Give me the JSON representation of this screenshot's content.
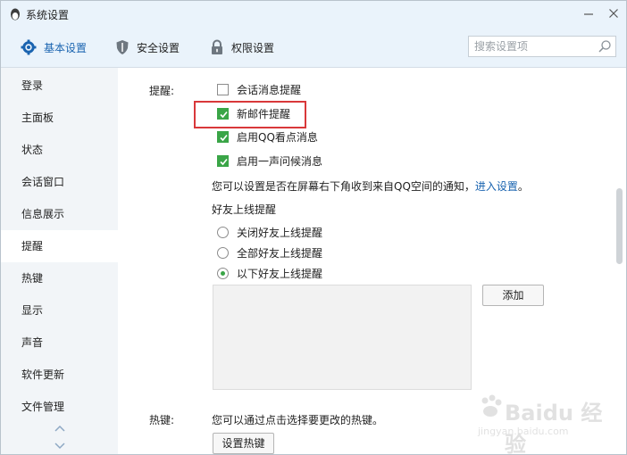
{
  "window": {
    "title": "系统设置"
  },
  "tabs": [
    {
      "label": "基本设置",
      "icon": "gear-icon",
      "active": true
    },
    {
      "label": "安全设置",
      "icon": "shield-icon",
      "active": false
    },
    {
      "label": "权限设置",
      "icon": "lock-icon",
      "active": false
    }
  ],
  "search": {
    "placeholder": "搜索设置项",
    "value": ""
  },
  "sidebar": {
    "items": [
      {
        "label": "登录"
      },
      {
        "label": "主面板"
      },
      {
        "label": "状态"
      },
      {
        "label": "会话窗口"
      },
      {
        "label": "信息展示"
      },
      {
        "label": "提醒",
        "active": true
      },
      {
        "label": "热键"
      },
      {
        "label": "显示"
      },
      {
        "label": "声音"
      },
      {
        "label": "软件更新"
      },
      {
        "label": "文件管理"
      }
    ]
  },
  "reminder": {
    "label": "提醒:",
    "options": [
      {
        "label": "会话消息提醒",
        "checked": false
      },
      {
        "label": "新邮件提醒",
        "checked": true
      },
      {
        "label": "启用QQ看点消息",
        "checked": true
      },
      {
        "label": "启用一声问候消息",
        "checked": true
      }
    ],
    "note": "您可以设置是否在屏幕右下角收到来自QQ空间的通知，",
    "note_link": "进入设置",
    "note_end": "。",
    "friend_online": {
      "title": "好友上线提醒",
      "options": [
        {
          "label": "关闭好友上线提醒",
          "selected": false
        },
        {
          "label": "全部好友上线提醒",
          "selected": false
        },
        {
          "label": "以下好友上线提醒",
          "selected": true
        }
      ],
      "add_button": "添加"
    }
  },
  "hotkey": {
    "label": "热键:",
    "note": "您可以通过点击选择要更改的热键。",
    "button": "设置热键"
  },
  "watermark": {
    "text": "Baidu 经验",
    "url": "jingyan.baidu.com"
  },
  "colors": {
    "accent": "#1a64b0",
    "check": "#3aa547",
    "highlight": "#d9383a",
    "titlebar": "#eaf3fb",
    "sidebar": "#f2f5f8"
  }
}
